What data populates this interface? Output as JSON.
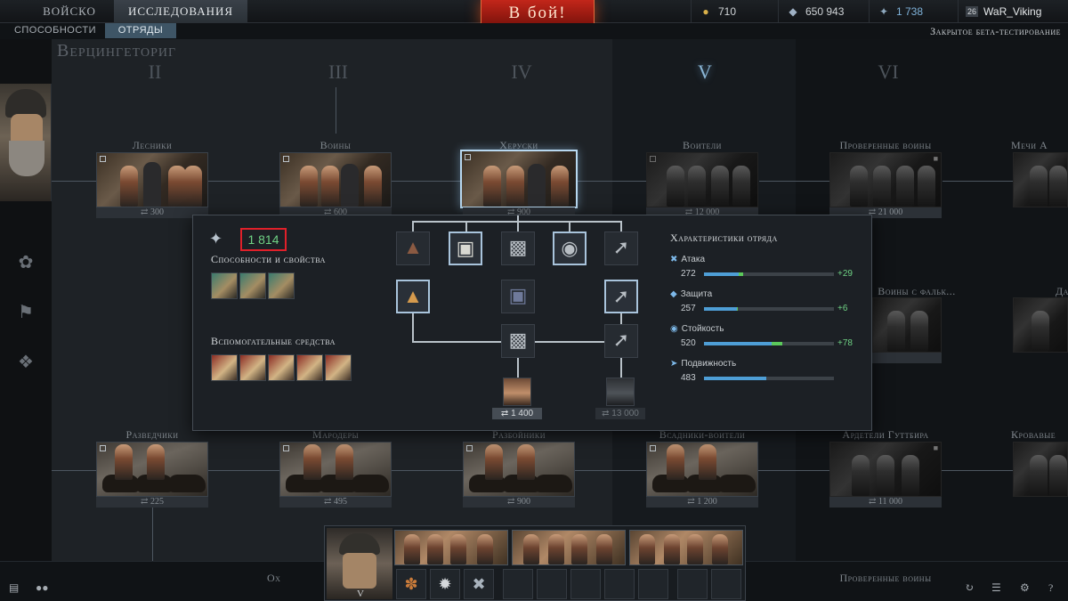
{
  "top_bar": {
    "tabs": [
      {
        "label": "Войско"
      },
      {
        "label": "Исследования",
        "active": true
      }
    ],
    "battle_button": "В бой!",
    "resources": {
      "gold": {
        "value": "710",
        "icon": "gold-icon"
      },
      "silver": {
        "value": "650 943",
        "icon": "silver-icon"
      },
      "experience": {
        "value": "1 738",
        "icon": "experience-eagle-icon"
      }
    },
    "profile": {
      "level": "26",
      "name": "WaR_Viking"
    }
  },
  "sub_bar": {
    "tabs": [
      {
        "label": "Способности"
      },
      {
        "label": "Отряды",
        "active": true
      }
    ],
    "status": "Закрытое бета-тестирование"
  },
  "tree": {
    "leader_name": "Верцингеториг",
    "eras": [
      "II",
      "III",
      "IV",
      "V",
      "VI"
    ],
    "active_era": "V",
    "row1": [
      {
        "title": "Лесники",
        "cost": "300"
      },
      {
        "title": "Воины",
        "cost": "600"
      },
      {
        "title": "Херуски",
        "cost": "900",
        "selected": true
      },
      {
        "title": "Воители",
        "cost": "12 000"
      },
      {
        "title": "Проверенные воины",
        "cost": "21 000",
        "locked": true
      },
      {
        "title": "Мечи А",
        "cost": ""
      }
    ],
    "row2": [
      {
        "title": "Воины с фальк...",
        "cost": ""
      },
      {
        "title": "Да",
        "cost": ""
      }
    ],
    "row3": [
      {
        "title": "Разведчики",
        "cost": "225"
      },
      {
        "title": "Мародеры",
        "cost": "495"
      },
      {
        "title": "Разбойники",
        "cost": "900"
      },
      {
        "title": "Всадники-воители",
        "cost": "1 200"
      },
      {
        "title": "Ардетели Гуттбира",
        "cost": "11 000",
        "locked": true
      },
      {
        "title": "Кровавые",
        "cost": ""
      }
    ]
  },
  "left_rail": {
    "icons": [
      "owl-icon",
      "boar-icon",
      "eagle-emblem-icon"
    ]
  },
  "detail": {
    "research_cost": "1 814",
    "abilities_heading": "Способности и свойства",
    "abilities_count": 3,
    "auxiliary_heading": "Вспомогательные средства",
    "auxiliary_count": 5,
    "equipment": [
      "hood-icon",
      "trousers-icon",
      "armor-icon",
      "helmet-icon",
      "spear-icon",
      "cap-icon",
      "tunic-icon",
      "spears-icon",
      "chainmail-icon",
      "javelin-icon"
    ],
    "next_units": [
      {
        "cost": "1 400",
        "icon": "warrior-portrait-icon"
      },
      {
        "cost": "13 000",
        "icon": "armored-warrior-portrait-icon",
        "locked": true
      }
    ],
    "stats_heading": "Характеристики отряда",
    "stats": [
      {
        "label": "Атака",
        "value": "272",
        "bonus": "+29",
        "fill": 0.27,
        "bonus_fill": 0.03,
        "icon": "crossed-swords-icon"
      },
      {
        "label": "Защита",
        "value": "257",
        "bonus": "+6",
        "fill": 0.25,
        "bonus_fill": 0.01,
        "icon": "shield-icon"
      },
      {
        "label": "Стойкость",
        "value": "520",
        "bonus": "+78",
        "fill": 0.52,
        "bonus_fill": 0.08,
        "icon": "helmet-icon"
      },
      {
        "label": "Подвижность",
        "value": "483",
        "bonus": "",
        "fill": 0.48,
        "bonus_fill": 0,
        "icon": "running-icon"
      }
    ]
  },
  "bottom": {
    "squad_era": "V",
    "slots": 3,
    "ability_slots": 3,
    "empty_slots": 7,
    "icons": [
      "chat-icon",
      "friends-icon",
      "history-icon",
      "squad-settings-icon",
      "gear-icon",
      "help-icon"
    ],
    "partial_label": "Ох",
    "partial_label_2": "Проверенные воины"
  },
  "colors": {
    "accent_red": "#c2261a",
    "highlight_blue": "#8ab6d6",
    "bar_blue": "#4e9ed6",
    "bonus_green": "#5bc95b",
    "cost_outline": "#e0202a"
  }
}
